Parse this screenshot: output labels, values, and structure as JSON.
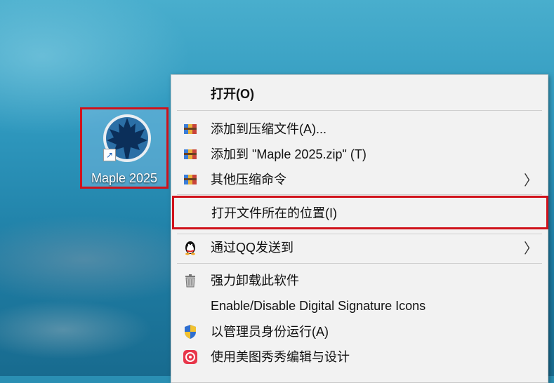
{
  "desktop": {
    "icon": {
      "label": "Maple 2025",
      "icon_name": "maple-leaf-icon",
      "shortcut_overlay": "shortcut-arrow-icon"
    }
  },
  "context_menu": {
    "items": [
      {
        "label": "打开(O)",
        "bold": true
      },
      {
        "label": "添加到压缩文件(A)...",
        "icon": "winrar-archive-icon"
      },
      {
        "label": "添加到 \"Maple 2025.zip\" (T)",
        "icon": "winrar-archive-icon"
      },
      {
        "label": "其他压缩命令",
        "icon": "winrar-archive-icon",
        "submenu_glyph": "〉"
      },
      {
        "label": "打开文件所在的位置(I)",
        "highlighted": true
      },
      {
        "label": "通过QQ发送到",
        "icon": "qq-penguin-icon",
        "submenu_glyph": "〉"
      },
      {
        "label": "强力卸载此软件",
        "icon": "trash-can-icon"
      },
      {
        "label": "Enable/Disable Digital Signature Icons"
      },
      {
        "label": "以管理员身份运行(A)",
        "icon": "uac-shield-icon"
      },
      {
        "label": "使用美图秀秀编辑与设计",
        "icon": "meitu-icon"
      }
    ]
  },
  "colors": {
    "highlight_border": "#d0121b",
    "menu_background": "#f2f2f2"
  }
}
